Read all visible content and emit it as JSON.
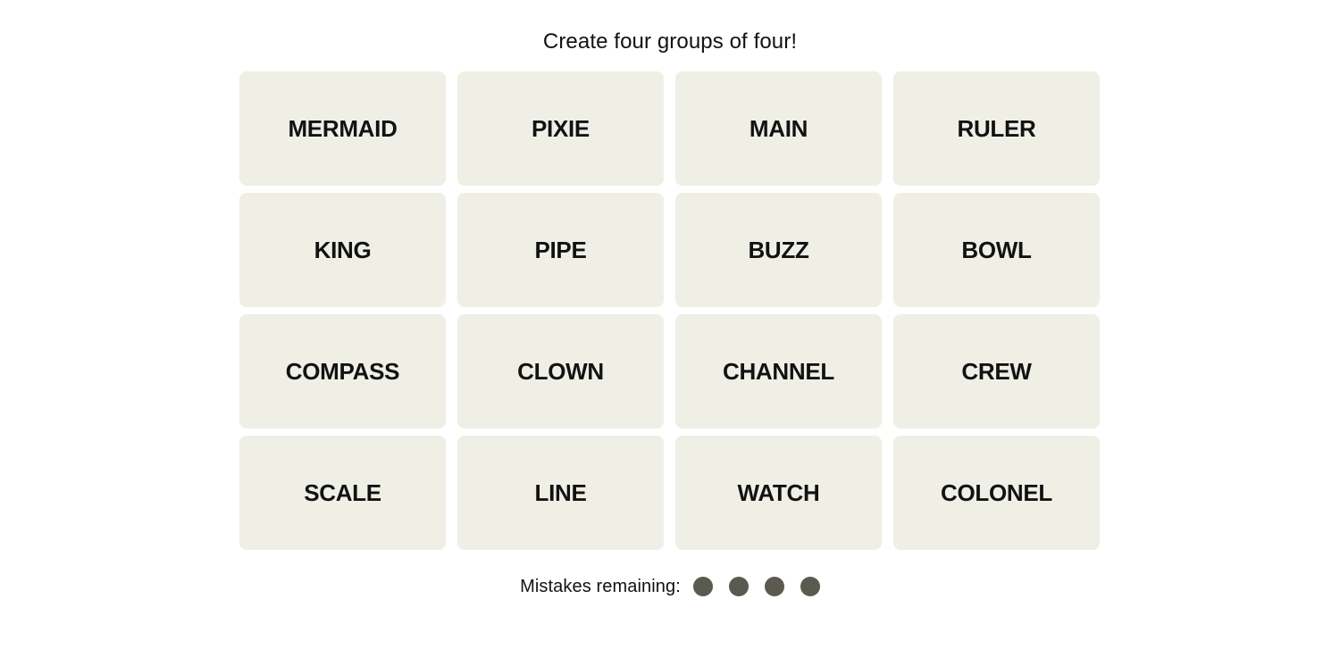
{
  "game": {
    "title": "Create four groups of four!",
    "tile_background_color": "#efefe6",
    "tile_text_color": "#121212",
    "page_background_color": "#ffffff",
    "tiles": [
      {
        "label": "MERMAID"
      },
      {
        "label": "PIXIE"
      },
      {
        "label": "MAIN"
      },
      {
        "label": "RULER"
      },
      {
        "label": "KING"
      },
      {
        "label": "PIPE"
      },
      {
        "label": "BUZZ"
      },
      {
        "label": "BOWL"
      },
      {
        "label": "COMPASS"
      },
      {
        "label": "CLOWN"
      },
      {
        "label": "CHANNEL"
      },
      {
        "label": "CREW"
      },
      {
        "label": "SCALE"
      },
      {
        "label": "LINE"
      },
      {
        "label": "WATCH"
      },
      {
        "label": "COLONEL"
      }
    ],
    "footer": {
      "mistakes_label": "Mistakes remaining:",
      "mistakes_remaining": 4,
      "dot_color": "#5a5a4e"
    }
  }
}
